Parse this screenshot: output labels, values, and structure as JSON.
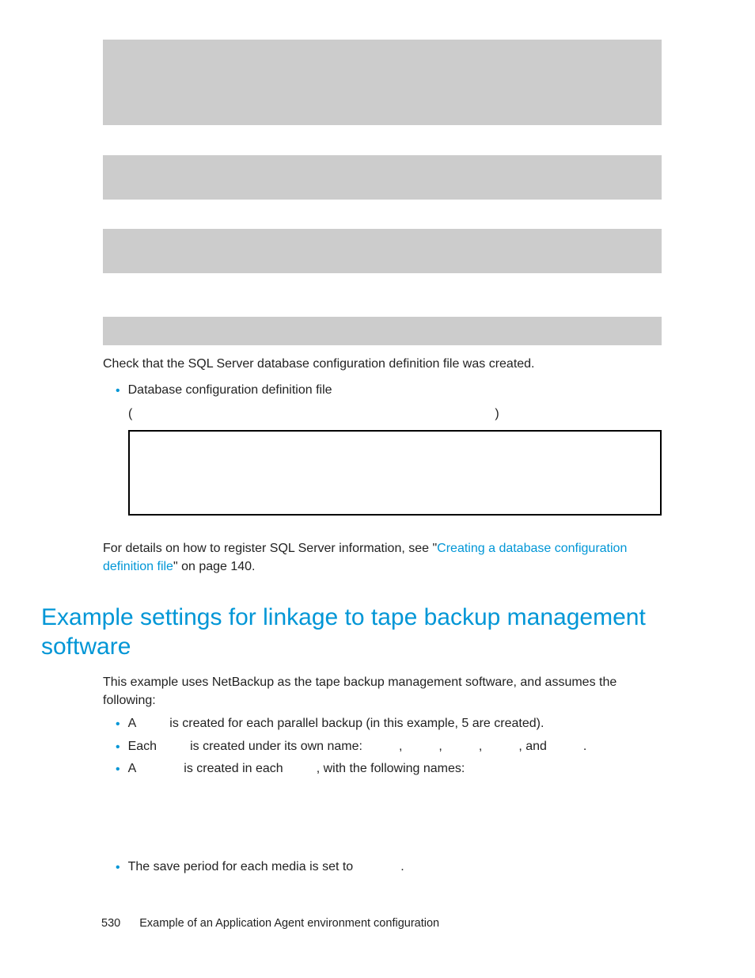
{
  "check_line": "Check that the SQL Server database configuration definition file was created.",
  "bullet1": "Database configuration definition file",
  "paren_open": "(",
  "paren_close": ")",
  "details_prefix": "For details on how to register SQL Server information, see \"",
  "details_link": "Creating a database configuration definition file",
  "details_suffix": "\" on page 140.",
  "heading": "Example settings for linkage to tape backup management software",
  "intro": "This example uses NetBackup as the tape backup management software, and assumes the following:",
  "li1_a": "A",
  "li1_b": "is created for each parallel backup (in this example, 5 are created).",
  "li2_a": "Each",
  "li2_b": "is created under its own name:",
  "li2_c": ",",
  "li2_d": ",",
  "li2_e": ",",
  "li2_f": ", and",
  "li2_g": ".",
  "li3_a": "A",
  "li3_b": "is created in each",
  "li3_c": ", with the following names:",
  "li4_a": "The save period for each media is set to",
  "li4_b": ".",
  "footer_page": "530",
  "footer_text": "Example of an Application Agent environment configuration"
}
